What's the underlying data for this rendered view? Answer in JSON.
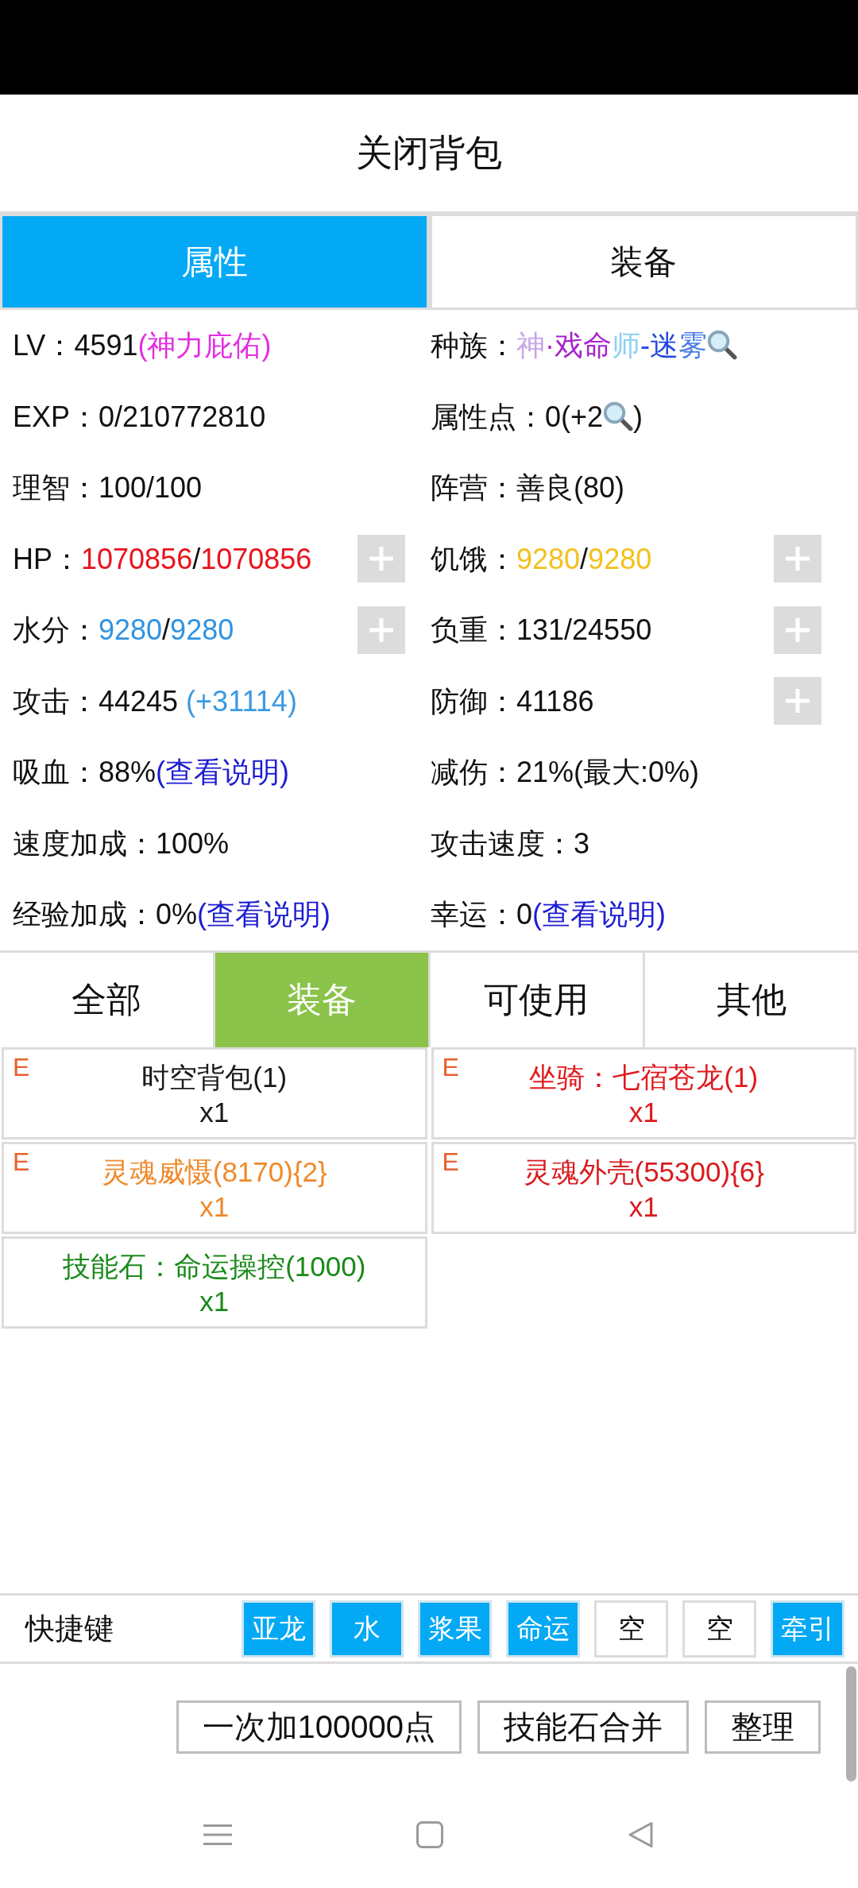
{
  "title": "关闭背包",
  "top_tabs": [
    {
      "label": "属性",
      "selected": true
    },
    {
      "label": "装备",
      "selected": false
    }
  ],
  "stats": [
    {
      "label": "LV：",
      "parts": [
        {
          "kind": "text",
          "text": "4591",
          "color": "#111111"
        },
        {
          "kind": "text",
          "text": "(神力庇佑)",
          "color": "#e22ee2"
        }
      ],
      "plus": false
    },
    {
      "label": "种族：",
      "parts": [
        {
          "kind": "text",
          "text": "神",
          "color": "#c9a6e6"
        },
        {
          "kind": "text",
          "text": "·戏命",
          "color": "#a624cc"
        },
        {
          "kind": "text",
          "text": "师",
          "color": "#8fd0f2"
        },
        {
          "kind": "text",
          "text": "-迷",
          "color": "#2448e0"
        },
        {
          "kind": "text",
          "text": "雾",
          "color": "#4a7ee6"
        },
        {
          "kind": "icon"
        }
      ],
      "plus": false
    },
    {
      "label": "EXP：",
      "parts": [
        {
          "kind": "text",
          "text": "0/210772810",
          "color": "#111111"
        }
      ],
      "plus": false
    },
    {
      "label": "属性点：",
      "parts": [
        {
          "kind": "text",
          "text": "0(+2",
          "color": "#111111"
        },
        {
          "kind": "icon"
        },
        {
          "kind": "text",
          "text": ")",
          "color": "#111111"
        }
      ],
      "plus": false
    },
    {
      "label": "理智：",
      "parts": [
        {
          "kind": "text",
          "text": "100/100",
          "color": "#111111"
        }
      ],
      "plus": false
    },
    {
      "label": "阵营：",
      "parts": [
        {
          "kind": "text",
          "text": "善良(80)",
          "color": "#111111"
        }
      ],
      "plus": false
    },
    {
      "label": "HP：",
      "parts": [
        {
          "kind": "text",
          "text": "1070856",
          "color": "#e8141e"
        },
        {
          "kind": "text",
          "text": "/",
          "color": "#111111"
        },
        {
          "kind": "text",
          "text": "1070856",
          "color": "#e8141e"
        }
      ],
      "plus": true
    },
    {
      "label": "饥饿：",
      "parts": [
        {
          "kind": "text",
          "text": "9280",
          "color": "#f2c11e"
        },
        {
          "kind": "text",
          "text": "/",
          "color": "#111111"
        },
        {
          "kind": "text",
          "text": "9280",
          "color": "#f2c11e"
        }
      ],
      "plus": true
    },
    {
      "label": "水分：",
      "parts": [
        {
          "kind": "text",
          "text": "9280",
          "color": "#2f93e2"
        },
        {
          "kind": "text",
          "text": "/",
          "color": "#111111"
        },
        {
          "kind": "text",
          "text": "9280",
          "color": "#2f93e2"
        }
      ],
      "plus": true
    },
    {
      "label": "负重：",
      "parts": [
        {
          "kind": "text",
          "text": "131/24550",
          "color": "#111111"
        }
      ],
      "plus": true
    },
    {
      "label": "攻击：",
      "parts": [
        {
          "kind": "text",
          "text": "44245",
          "color": "#111111"
        },
        {
          "kind": "text",
          "text": " (+31114)",
          "color": "#3a9ae2"
        }
      ],
      "plus": false
    },
    {
      "label": "防御：",
      "parts": [
        {
          "kind": "text",
          "text": "41186",
          "color": "#111111"
        }
      ],
      "plus": true
    },
    {
      "label": "吸血：",
      "parts": [
        {
          "kind": "text",
          "text": "88%",
          "color": "#111111"
        },
        {
          "kind": "link",
          "text": "(查看说明)",
          "color": "#1c1cd2"
        }
      ],
      "plus": false
    },
    {
      "label": "减伤：",
      "parts": [
        {
          "kind": "text",
          "text": "21%(最大:0%)",
          "color": "#111111"
        }
      ],
      "plus": false
    },
    {
      "label": "速度加成：",
      "parts": [
        {
          "kind": "text",
          "text": "100%",
          "color": "#111111"
        }
      ],
      "plus": false
    },
    {
      "label": "攻击速度：",
      "parts": [
        {
          "kind": "text",
          "text": "3",
          "color": "#111111"
        }
      ],
      "plus": false
    },
    {
      "label": "经验加成：",
      "parts": [
        {
          "kind": "text",
          "text": "0%",
          "color": "#111111"
        },
        {
          "kind": "link",
          "text": "(查看说明)",
          "color": "#1c1cd2"
        }
      ],
      "plus": false
    },
    {
      "label": "幸运：",
      "parts": [
        {
          "kind": "text",
          "text": "0",
          "color": "#111111"
        },
        {
          "kind": "link",
          "text": "(查看说明)",
          "color": "#1c1cd2"
        }
      ],
      "plus": false
    }
  ],
  "filter_tabs": [
    {
      "label": "全部",
      "selected": false
    },
    {
      "label": "装备",
      "selected": true
    },
    {
      "label": "可使用",
      "selected": false
    },
    {
      "label": "其他",
      "selected": false
    }
  ],
  "items": [
    {
      "tag": "E",
      "name": "时空背包(1)",
      "count": "x1",
      "color": "#1a1a1a"
    },
    {
      "tag": "E",
      "name": "坐骑：七宿苍龙(1)",
      "count": "x1",
      "color": "#e01a1e"
    },
    {
      "tag": "E",
      "name": "灵魂威慑(8170){2}",
      "count": "x1",
      "color": "#ee8a2c"
    },
    {
      "tag": "E",
      "name": "灵魂外壳(55300){6}",
      "count": "x1",
      "color": "#d81c20"
    },
    {
      "name": "技能石：命运操控(1000)",
      "count": "x1",
      "color": "#1a8a1a"
    }
  ],
  "shortcuts": {
    "label": "快捷键",
    "keys": [
      {
        "label": "亚龙",
        "assigned": true
      },
      {
        "label": "水",
        "assigned": true
      },
      {
        "label": "浆果",
        "assigned": true
      },
      {
        "label": "命运",
        "assigned": true
      },
      {
        "label": "空",
        "assigned": false
      },
      {
        "label": "空",
        "assigned": false
      },
      {
        "label": "牵引",
        "assigned": true
      }
    ]
  },
  "actions": [
    "一次加100000点",
    "技能石合并",
    "整理"
  ]
}
